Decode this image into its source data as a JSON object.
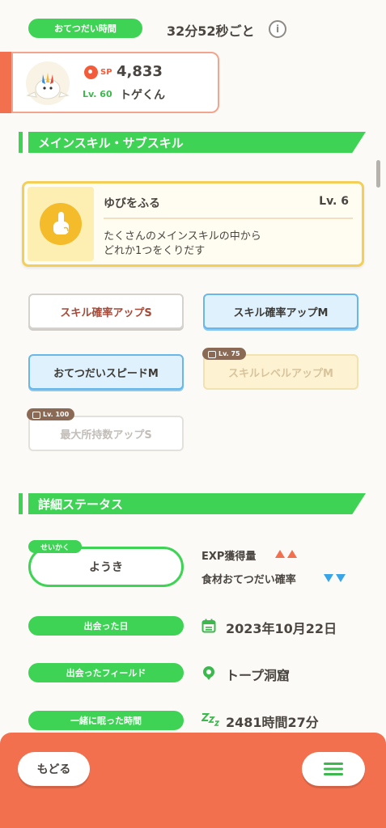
{
  "help": {
    "interval_label": "おてつだい時間",
    "interval_value": "32分52秒ごと",
    "info_glyph": "i"
  },
  "pokemon": {
    "sp_label": "SP",
    "sp_value": "4,833",
    "level_label": "Lv. 60",
    "name": "トゲくん"
  },
  "sections": {
    "skills_title": "メインスキル・サブスキル",
    "details_title": "詳細ステータス"
  },
  "main_skill": {
    "name": "ゆびをふる",
    "level": "Lv. 6",
    "desc_line1": "たくさんのメインスキルの中から",
    "desc_line2": "どれか1つをくりだす"
  },
  "sub_skills": [
    {
      "label": "スキル確率アップS",
      "lock": ""
    },
    {
      "label": "スキル確率アップM",
      "lock": ""
    },
    {
      "label": "おてつだいスピードM",
      "lock": ""
    },
    {
      "label": "スキルレベルアップM",
      "lock": "Lv. 75"
    },
    {
      "label": "最大所持数アップS",
      "lock": "Lv. 100"
    }
  ],
  "nature": {
    "tag": "せいかく",
    "value": "ようき",
    "up_effect": "EXP獲得量",
    "down_effect": "食材おてつだい確率"
  },
  "details": {
    "met_date_label": "出会った日",
    "met_date_value": "2023年10月22日",
    "field_label": "出会ったフィールド",
    "field_value": "トープ洞窟",
    "sleep_label": "一緒に眠った時間",
    "sleep_value": "2481時間27分"
  },
  "nav": {
    "back_label": "もどる"
  },
  "icons": {
    "info": "info-icon",
    "sp": "sp-ball-icon",
    "skill": "finger-icon",
    "lock": "lock-icon",
    "calendar": "calendar-icon",
    "field": "field-pin-icon",
    "sleep": "zzz-icon",
    "menu": "hamburger-menu-icon"
  },
  "colors": {
    "accent_green": "#3ed354",
    "accent_orange": "#f2704e",
    "skill_gold": "#f3cf5a",
    "stat_up": "#f2704e",
    "stat_down": "#3aa4e8"
  }
}
